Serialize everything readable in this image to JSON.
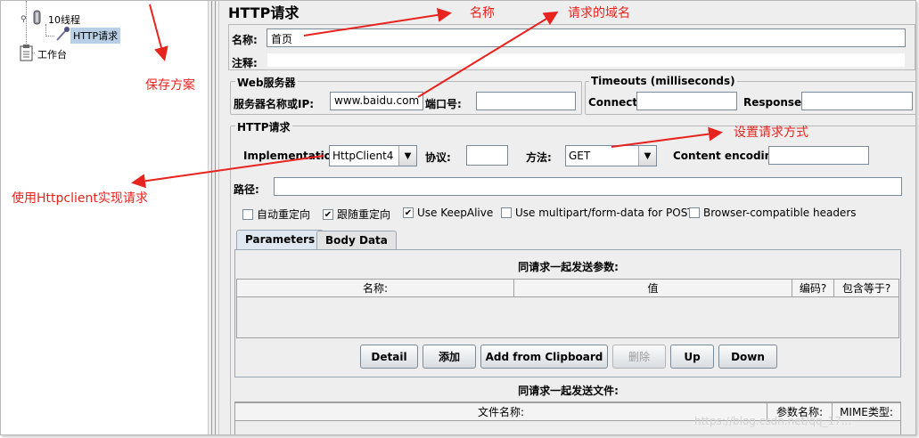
{
  "tree": {
    "thread_group_label": "10线程",
    "http_request_label": "HTTP请求",
    "workbench_label": "工作台"
  },
  "form": {
    "title": "HTTP请求",
    "name_label": "名称:",
    "name_value": "首页",
    "comment_label": "注释:",
    "web_server": {
      "title": "Web服务器",
      "server_label": "服务器名称或IP:",
      "server_value": "www.baidu.com",
      "port_label": "端口号:"
    },
    "timeouts": {
      "title": "Timeouts (milliseconds)",
      "connect_label": "Connect:",
      "response_label": "Response:"
    },
    "http_request": {
      "title": "HTTP请求",
      "implementation_label": "Implementation:",
      "implementation_value": "HttpClient4",
      "protocol_label": "协议:",
      "method_label": "方法:",
      "method_value": "GET",
      "encoding_label": "Content encoding:",
      "path_label": "路径:"
    },
    "options": {
      "auto_redirect": "自动重定向",
      "follow_redirect": "跟随重定向",
      "keepalive": "Use KeepAlive",
      "multipart": "Use multipart/form-data for POST",
      "browser_headers": "Browser-compatible headers"
    },
    "tabs": {
      "parameters": "Parameters",
      "body": "Body Data"
    },
    "params": {
      "caption": "同请求一起发送参数:",
      "col_name": "名称:",
      "col_value": "值",
      "col_encode": "编码?",
      "col_include_equals": "包含等于?"
    },
    "buttons": {
      "detail": "Detail",
      "add": "添加",
      "add_clipboard": "Add from Clipboard",
      "delete": "删除",
      "up": "Up",
      "down": "Down"
    },
    "files": {
      "caption": "同请求一起发送文件:",
      "col_file": "文件名称:",
      "col_param": "参数名称:",
      "col_mime": "MIME类型:"
    }
  },
  "annotations": {
    "name": "名称",
    "domain": "请求的域名",
    "save_plan": "保存方案",
    "method": "设置请求方式",
    "httpclient": "使用Httpclient实现请求"
  },
  "watermark": "https://blog.csdn.net/qq_17..."
}
